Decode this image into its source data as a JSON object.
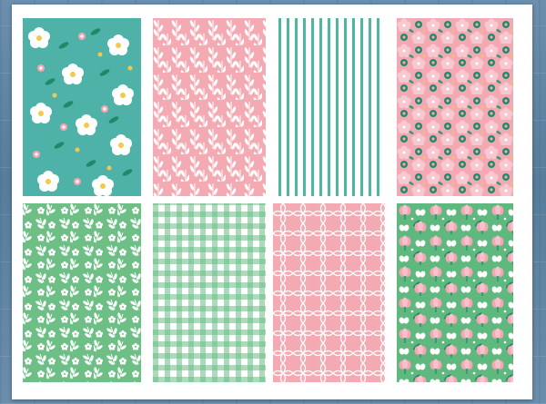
{
  "scene": {
    "description_colors": {
      "board_blue": "#5f84a3",
      "sheet_white": "#ffffff",
      "teal": "#4fb69f",
      "mint_green": "#6cbf86",
      "pink": "#f4adb6",
      "white": "#ffffff"
    },
    "panels": [
      {
        "id": "panel-1",
        "pattern": "white-flowers-on-teal"
      },
      {
        "id": "panel-2",
        "pattern": "white-leaves-on-pink"
      },
      {
        "id": "panel-3",
        "pattern": "teal-vertical-stripes"
      },
      {
        "id": "panel-4",
        "pattern": "pink-flowers-with-green-dots"
      },
      {
        "id": "panel-5",
        "pattern": "white-leaves-on-green"
      },
      {
        "id": "panel-6",
        "pattern": "green-gingham"
      },
      {
        "id": "panel-7",
        "pattern": "pink-quatrefoil"
      },
      {
        "id": "panel-8",
        "pattern": "pink-flowers-butterflies-on-green"
      }
    ]
  }
}
